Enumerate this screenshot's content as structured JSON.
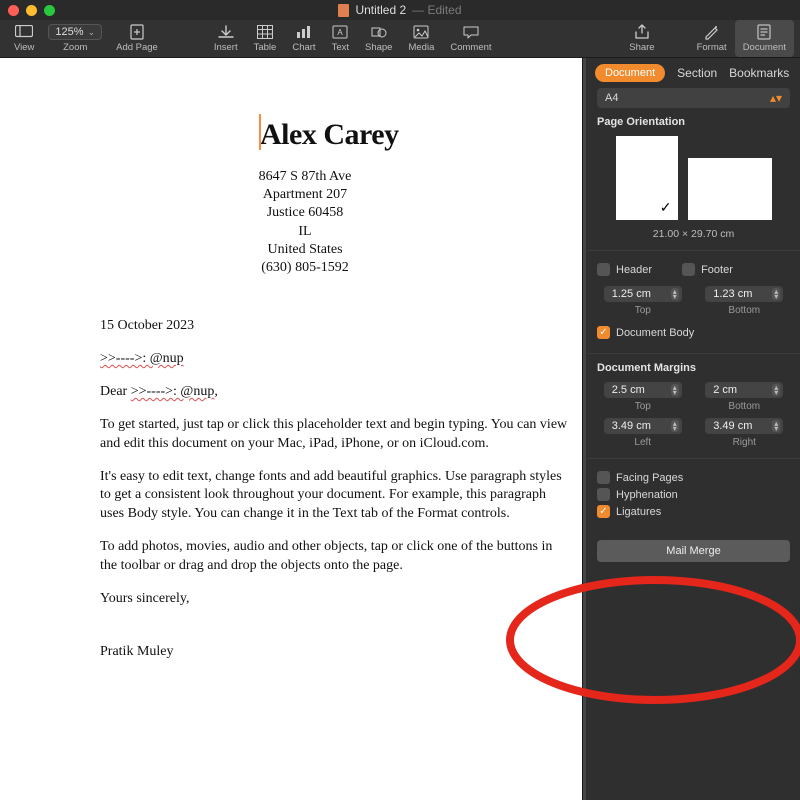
{
  "window": {
    "title": "Untitled 2",
    "edited_suffix": "— Edited"
  },
  "toolbar": {
    "view": "View",
    "zoom_value": "125%",
    "zoom_label": "Zoom",
    "add_page": "Add Page",
    "insert": "Insert",
    "table": "Table",
    "chart": "Chart",
    "text": "Text",
    "shape": "Shape",
    "media": "Media",
    "comment": "Comment",
    "share": "Share",
    "format": "Format",
    "document": "Document"
  },
  "letter": {
    "name": "Alex Carey",
    "address": {
      "line1": "8647 S 87th Ave",
      "line2": "Apartment 207",
      "line3": "Justice 60458",
      "line4": "IL",
      "line5": "United States",
      "phone": "(630) 805-1592"
    },
    "date": "15 October 2023",
    "merge_line": ">>---->: @nup",
    "salutation_prefix": "Dear ",
    "salutation_merge": ">>---->: @nup",
    "salutation_suffix": ",",
    "p1": "To get started, just tap or click this placeholder text and begin typing. You can view and edit this document on your Mac, iPad, iPhone, or on iCloud.com.",
    "p2": "It's easy to edit text, change fonts and add beautiful graphics. Use paragraph styles to get a consistent look throughout your document. For example, this paragraph uses Body style. You can change it in the Text tab of the Format controls.",
    "p3": "To add photos, movies, audio and other objects, tap or click one of the buttons in the toolbar or drag and drop the objects onto the page.",
    "closing": "Yours sincerely,",
    "signature": "Pratik Muley"
  },
  "inspector": {
    "tabs": {
      "document": "Document",
      "section": "Section",
      "bookmarks": "Bookmarks"
    },
    "paper_size": "A4",
    "page_orientation_label": "Page Orientation",
    "page_size_text": "21.00 × 29.70 cm",
    "header_label": "Header",
    "footer_label": "Footer",
    "header_value": "1.25 cm",
    "header_sub": "Top",
    "footer_value": "1.23 cm",
    "footer_sub": "Bottom",
    "document_body": "Document Body",
    "margins_label": "Document Margins",
    "margin_top": "2.5 cm",
    "margin_top_sub": "Top",
    "margin_bottom": "2 cm",
    "margin_bottom_sub": "Bottom",
    "margin_left": "3.49 cm",
    "margin_left_sub": "Left",
    "margin_right": "3.49 cm",
    "margin_right_sub": "Right",
    "facing_pages": "Facing Pages",
    "hyphenation": "Hyphenation",
    "ligatures": "Ligatures",
    "mail_merge": "Mail Merge"
  }
}
